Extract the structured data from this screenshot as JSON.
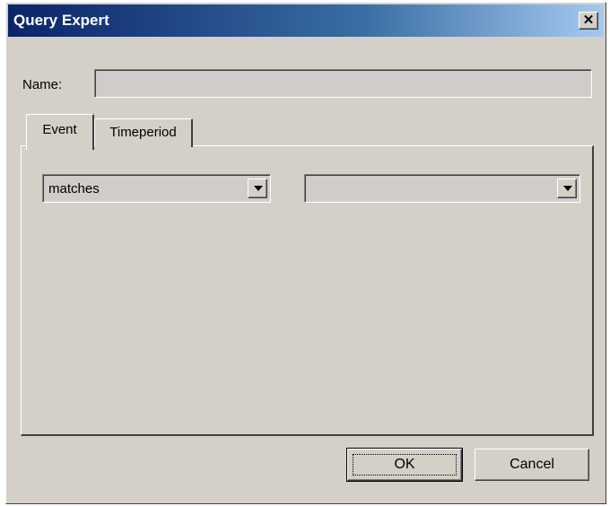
{
  "window": {
    "title": "Query Expert",
    "close_glyph": "✕"
  },
  "name_field": {
    "label": "Name:",
    "value": ""
  },
  "tabs": [
    {
      "label": "Event",
      "selected": true
    },
    {
      "label": "Timeperiod",
      "selected": false
    }
  ],
  "event_panel": {
    "operator_select": {
      "value": "matches"
    },
    "value_select": {
      "value": ""
    }
  },
  "buttons": {
    "ok_label": "OK",
    "cancel_label": "Cancel"
  },
  "colors": {
    "title_bar_start": "#0a246a",
    "title_bar_end": "#a6caf0",
    "face": "#d4d0c8"
  }
}
